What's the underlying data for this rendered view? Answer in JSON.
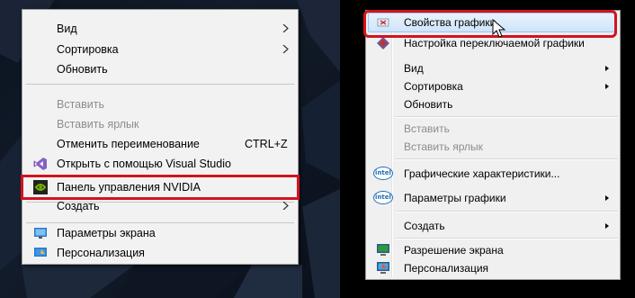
{
  "left_menu": {
    "items": [
      {
        "label": "Вид",
        "submenu": true
      },
      {
        "label": "Сортировка",
        "submenu": true
      },
      {
        "label": "Обновить"
      },
      {
        "label": "Вставить",
        "disabled": true
      },
      {
        "label": "Вставить ярлык",
        "disabled": true
      },
      {
        "label": "Отменить переименование",
        "shortcut": "CTRL+Z"
      },
      {
        "label": "Открыть с помощью Visual Studio",
        "icon": "visual-studio-icon"
      },
      {
        "label": "Панель управления NVIDIA",
        "icon": "nvidia-icon",
        "highlighted": true
      },
      {
        "label": "Создать",
        "submenu": true
      },
      {
        "label": "Параметры экрана",
        "icon": "display-settings-icon"
      },
      {
        "label": "Персонализация",
        "icon": "personalization-icon"
      }
    ]
  },
  "right_menu": {
    "items": [
      {
        "label": "Свойства графики",
        "icon": "graphics-properties-icon",
        "hovered": true,
        "highlighted": true
      },
      {
        "label": "Настройка переключаемой графики",
        "icon": "switchable-graphics-icon"
      },
      {
        "label": "Вид",
        "submenu": true
      },
      {
        "label": "Сортировка",
        "submenu": true
      },
      {
        "label": "Обновить"
      },
      {
        "label": "Вставить",
        "disabled": true
      },
      {
        "label": "Вставить ярлык",
        "disabled": true
      },
      {
        "label": "Графические характеристики...",
        "icon": "intel-icon",
        "icon_text": "intel"
      },
      {
        "label": "Параметры графики",
        "icon": "intel-icon",
        "icon_text": "intel",
        "submenu": true
      },
      {
        "label": "Создать",
        "submenu": true
      },
      {
        "label": "Разрешение экрана",
        "icon": "screen-resolution-icon"
      },
      {
        "label": "Персонализация",
        "icon": "personalization-icon"
      }
    ]
  },
  "colors": {
    "highlight_border": "#d3121f",
    "menu_bg": "#f2f2f2",
    "hover_bg": "#cfe4f9"
  }
}
